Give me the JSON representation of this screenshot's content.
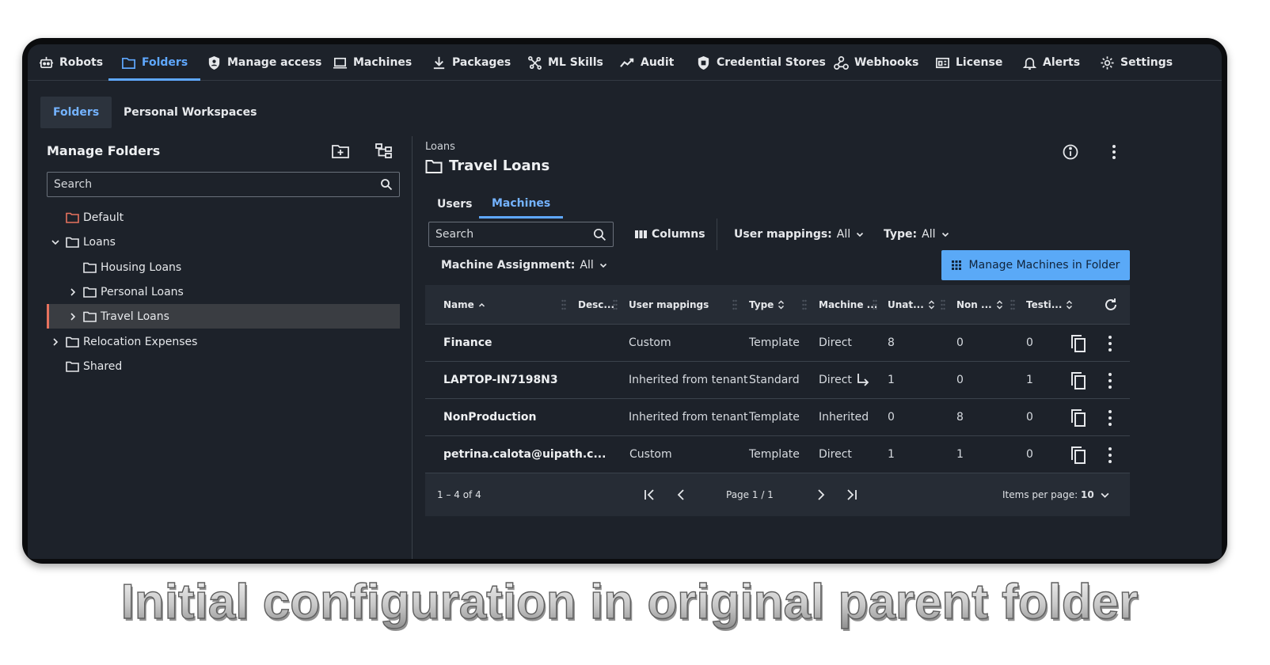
{
  "caption": "Initial configuration in original parent folder",
  "topnav": [
    {
      "label": "Robots",
      "icon": "robot-icon"
    },
    {
      "label": "Folders",
      "icon": "folder-icon",
      "active": true
    },
    {
      "label": "Manage access",
      "icon": "shield-icon"
    },
    {
      "label": "Machines",
      "icon": "laptop-icon"
    },
    {
      "label": "Packages",
      "icon": "download-icon"
    },
    {
      "label": "ML Skills",
      "icon": "ml-skills-icon"
    },
    {
      "label": "Audit",
      "icon": "audit-icon"
    },
    {
      "label": "Credential Stores",
      "icon": "credential-shield-icon"
    },
    {
      "label": "Webhooks",
      "icon": "webhooks-icon"
    },
    {
      "label": "License",
      "icon": "license-icon"
    },
    {
      "label": "Alerts",
      "icon": "bell-icon"
    },
    {
      "label": "Settings",
      "icon": "gear-icon"
    }
  ],
  "subtabs": [
    "Folders",
    "Personal Workspaces"
  ],
  "left": {
    "title": "Manage Folders",
    "search_placeholder": "Search",
    "tree": [
      {
        "label": "Default",
        "expander": "none",
        "color": "#e7725e"
      },
      {
        "label": "Loans",
        "expander": "down"
      },
      {
        "label": "Housing Loans",
        "expander": "none"
      },
      {
        "label": "Personal Loans",
        "expander": "right"
      },
      {
        "label": "Travel Loans",
        "expander": "right",
        "selected": true
      },
      {
        "label": "Relocation Expenses",
        "expander": "right"
      },
      {
        "label": "Shared",
        "expander": "none"
      }
    ]
  },
  "right": {
    "breadcrumb": "Loans",
    "title": "Travel Loans",
    "tabs": [
      "Users",
      "Machines"
    ],
    "search_placeholder": "Search",
    "columns_label": "Columns",
    "filters": {
      "user_mappings_label": "User mappings:",
      "user_mappings_value": "All",
      "type_label": "Type:",
      "type_value": "All",
      "machine_assignment_label": "Machine Assignment:",
      "machine_assignment_value": "All"
    },
    "manage_button": "Manage Machines in Folder"
  },
  "table": {
    "headers": {
      "name": "Name",
      "desc": "Desc...",
      "user_mappings": "User mappings",
      "type": "Type",
      "machine": "Machine ...",
      "unattended": "Unat...",
      "nonproduction": "Non ...",
      "testing": "Testi..."
    },
    "rows": [
      {
        "name": "Finance",
        "user_mappings": "Custom",
        "type": "Template",
        "machine": "Direct",
        "unattended": "8",
        "nonproduction": "0",
        "testing": "0",
        "inherit_arrow": false
      },
      {
        "name": "LAPTOP-IN7198N3",
        "user_mappings": "Inherited from tenant",
        "type": "Standard",
        "machine": "Direct",
        "unattended": "1",
        "nonproduction": "0",
        "testing": "1",
        "inherit_arrow": true
      },
      {
        "name": "NonProduction",
        "user_mappings": "Inherited from tenant",
        "type": "Template",
        "machine": "Inherited",
        "unattended": "0",
        "nonproduction": "8",
        "testing": "0",
        "inherit_arrow": false
      },
      {
        "name": "petrina.calota@uipath.c...",
        "user_mappings": "Custom",
        "type": "Template",
        "machine": "Direct",
        "unattended": "1",
        "nonproduction": "1",
        "testing": "0",
        "inherit_arrow": false
      }
    ],
    "footer": {
      "range": "1 – 4 of 4",
      "page": "Page 1 / 1",
      "items_per_page_label": "Items per page:",
      "items_per_page_value": "10"
    }
  },
  "colors": {
    "accent": "#5fa8ff",
    "button": "#5aa9f7",
    "selected_marker": "#e7725e",
    "background": "#1d222a"
  }
}
